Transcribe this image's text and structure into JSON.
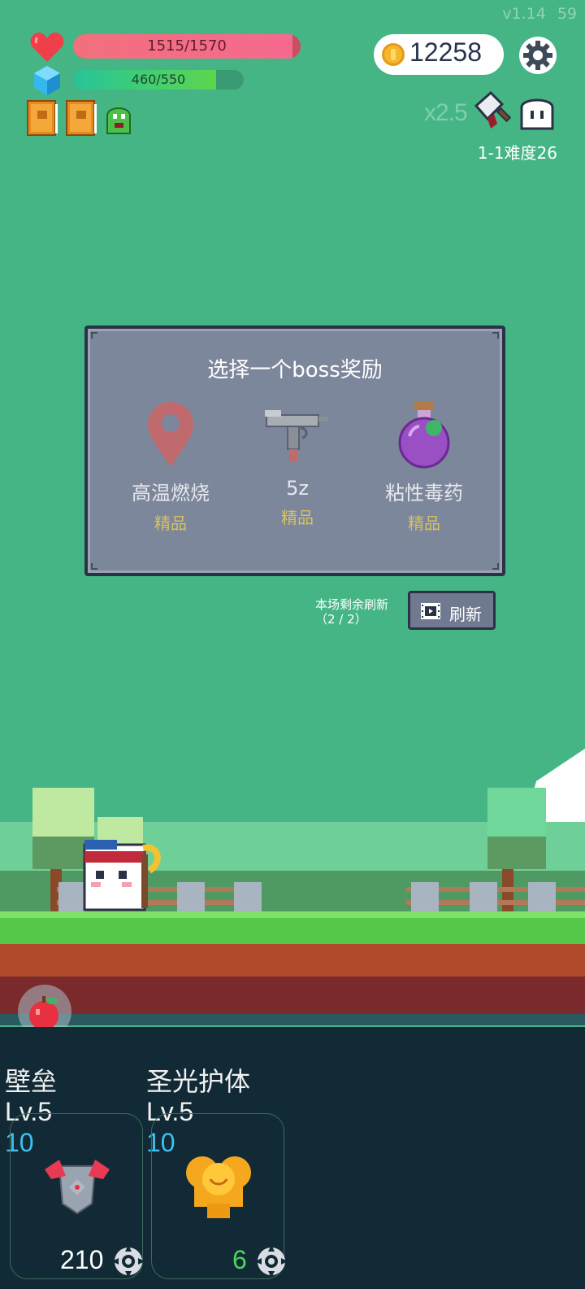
{
  "version": {
    "label": "v1.14",
    "fps": "59"
  },
  "hud": {
    "hp": {
      "text": "1515/1570",
      "current": 1515,
      "max": 1570
    },
    "mp": {
      "text": "460/550",
      "current": 460,
      "max": 550
    },
    "buffs": [
      "book-icon",
      "book-icon",
      "slime-icon"
    ],
    "coins": "12258",
    "speed": "x2.5",
    "stage": "1-1难度26"
  },
  "boss_reward": {
    "title": "选择一个boss奖励",
    "options": [
      {
        "name": "高温燃烧",
        "grade": "精品",
        "icon": "map-pin-icon"
      },
      {
        "name": "5z",
        "grade": "精品",
        "icon": "uzi-gun-icon"
      },
      {
        "name": "粘性毒药",
        "grade": "精品",
        "icon": "poison-flask-icon"
      }
    ],
    "refresh_hint_line1": "本场剩余刷新",
    "refresh_hint_line2": "（2 / 2）",
    "refresh_label": "刷新"
  },
  "skills": [
    {
      "name": "壁垒",
      "level": "Lv.5",
      "value": "10",
      "cost": "210",
      "cost_color": "#ffffff",
      "icon": "armor-icon"
    },
    {
      "name": "圣光护体",
      "level": "Lv.5",
      "value": "10",
      "cost": "6",
      "cost_color": "#49d65a",
      "icon": "holy-shield-icon"
    }
  ],
  "colors": {
    "sky": "#45b586",
    "panel": "#7d879b",
    "grade": "#d8c060",
    "accent_blue": "#3ec0ec"
  }
}
